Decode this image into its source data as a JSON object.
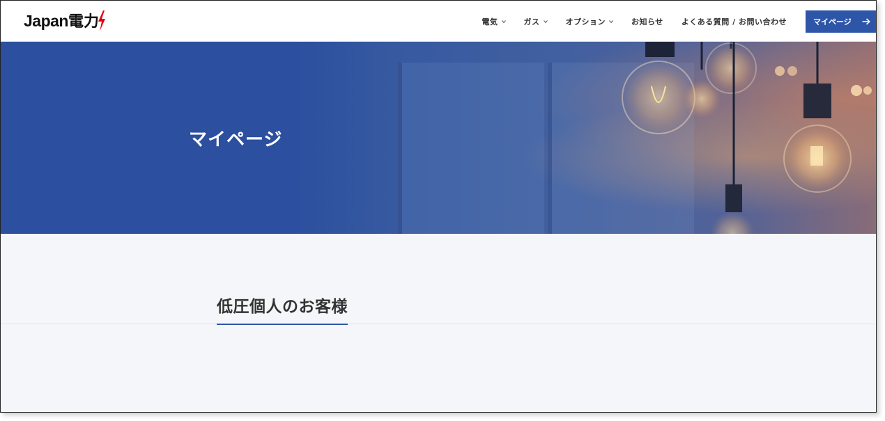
{
  "header": {
    "logo": {
      "text": "Japan",
      "mark": "電力"
    },
    "nav": [
      {
        "label": "電気",
        "has_dropdown": true
      },
      {
        "label": "ガス",
        "has_dropdown": true
      },
      {
        "label": "オプション",
        "has_dropdown": true
      },
      {
        "label": "お知らせ",
        "has_dropdown": false
      },
      {
        "label": "よくある質問 / お問い合わせ",
        "has_dropdown": false
      }
    ],
    "mypage_button": {
      "label": "マイページ",
      "icon": "arrow-right-icon"
    }
  },
  "hero": {
    "title": "マイページ"
  },
  "section": {
    "title": "低圧個人のお客様"
  },
  "colors": {
    "brand_blue": "#2d55a8",
    "hero_blue": "#2c4f9f",
    "logo_red": "#e60012",
    "page_bg": "#f5f6f9"
  }
}
